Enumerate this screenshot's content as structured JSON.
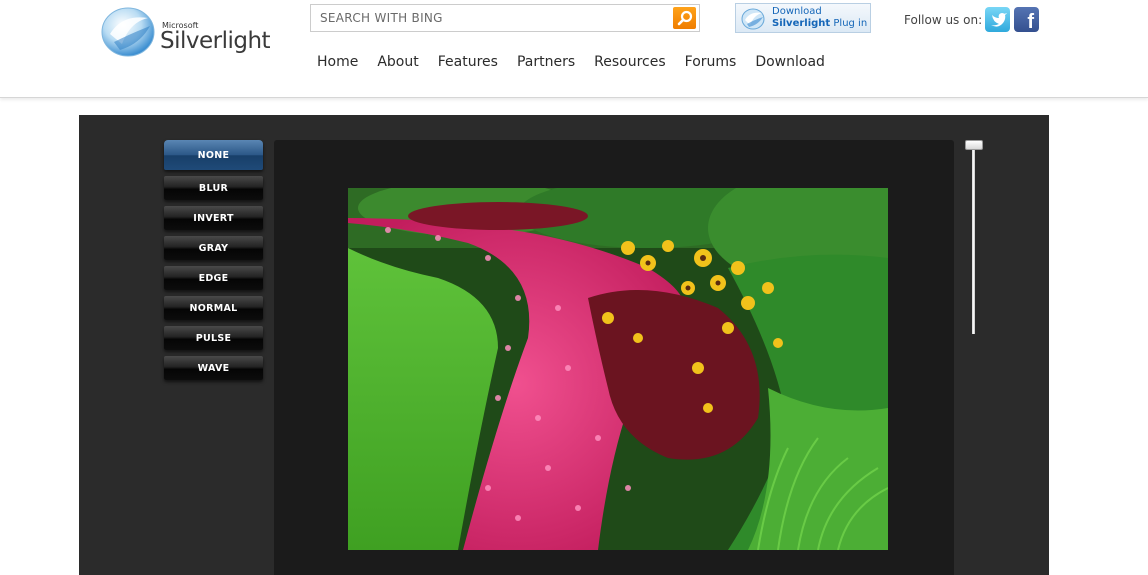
{
  "brand": {
    "small": "Microsoft",
    "name": "Silverlight",
    "logo_icon": "silverlight-logo-icon"
  },
  "search": {
    "placeholder": "SEARCH WITH BING",
    "button_icon": "search-icon",
    "accent": "#f48b00"
  },
  "download": {
    "line1": "Download",
    "line2_bold": "Silverlight",
    "line2_rest": " Plug in",
    "icon": "silverlight-logo-icon"
  },
  "social": {
    "label": "Follow us on:",
    "twitter_icon": "twitter-icon",
    "facebook_icon": "facebook-icon",
    "facebook_glyph": "f"
  },
  "nav": [
    {
      "label": "Home"
    },
    {
      "label": "About"
    },
    {
      "label": "Features"
    },
    {
      "label": "Partners"
    },
    {
      "label": "Resources"
    },
    {
      "label": "Forums"
    },
    {
      "label": "Download"
    }
  ],
  "demo": {
    "effects": [
      {
        "label": "NONE",
        "active": true
      },
      {
        "label": "BLUR",
        "active": false
      },
      {
        "label": "INVERT",
        "active": false
      },
      {
        "label": "GRAY",
        "active": false
      },
      {
        "label": "EDGE",
        "active": false
      },
      {
        "label": "NORMAL",
        "active": false
      },
      {
        "label": "PULSE",
        "active": false
      },
      {
        "label": "WAVE",
        "active": false
      }
    ],
    "active_color": "#2b5787",
    "slider_value": 0,
    "photo": "flower-garden-photo"
  }
}
